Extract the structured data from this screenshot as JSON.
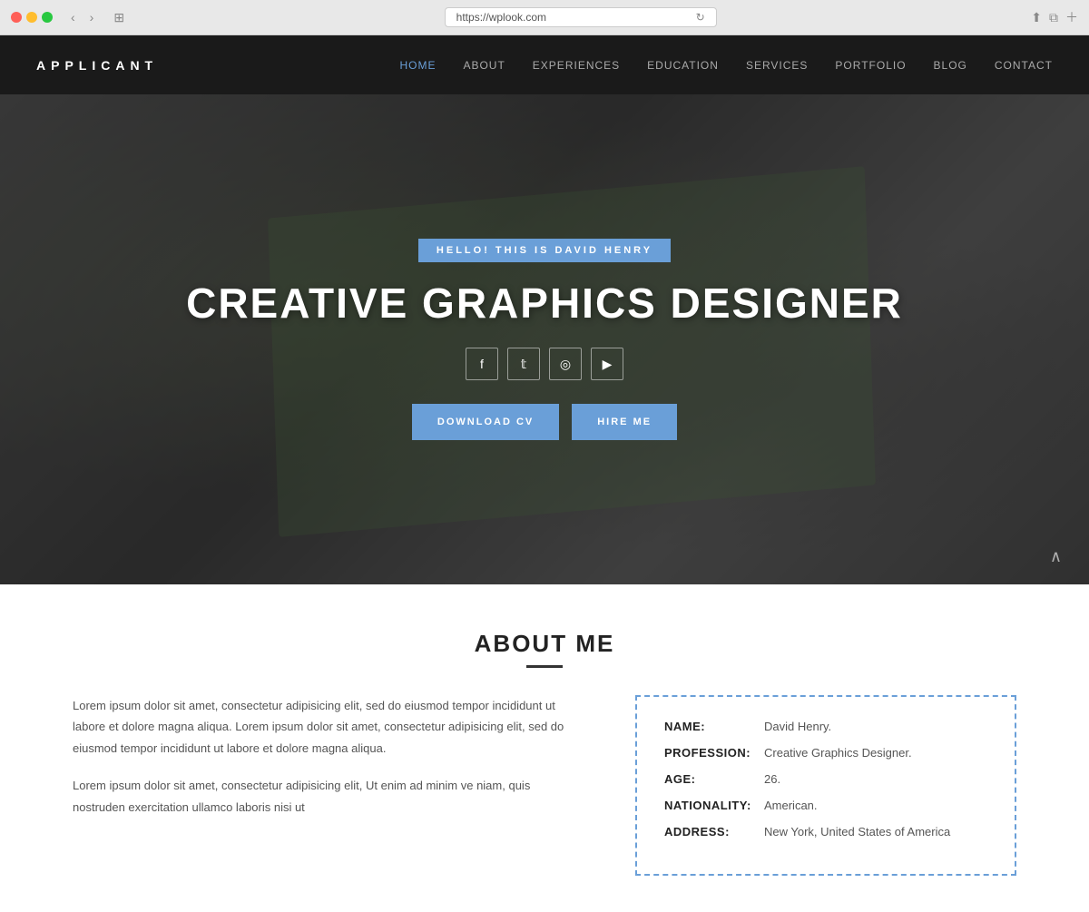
{
  "browser": {
    "url": "https://wplook.com",
    "refresh_icon": "↻"
  },
  "header": {
    "logo": "APPLICANT",
    "nav": [
      {
        "label": "HOME",
        "active": true
      },
      {
        "label": "ABOUT",
        "active": false
      },
      {
        "label": "EXPERIENCES",
        "active": false
      },
      {
        "label": "EDUCATION",
        "active": false
      },
      {
        "label": "SERVICES",
        "active": false
      },
      {
        "label": "PORTFOLIO",
        "active": false
      },
      {
        "label": "BLOG",
        "active": false
      },
      {
        "label": "CONTACT",
        "active": false
      }
    ]
  },
  "hero": {
    "badge": "HELLO! THIS IS DAVID HENRY",
    "title": "CREATIVE GRAPHICS DESIGNER",
    "social_icons": [
      "f",
      "t",
      "◎",
      "▶"
    ],
    "download_cv_label": "DOWNLOAD CV",
    "hire_me_label": "HIRE ME"
  },
  "about": {
    "section_title": "ABOUT ME",
    "paragraph1": "Lorem ipsum dolor sit amet, consectetur adipisicing elit, sed do eiusmod tempor incididunt ut labore et dolore magna aliqua. Lorem ipsum dolor sit amet, consectetur adipisicing elit, sed do eiusmod tempor incididunt ut labore et dolore magna aliqua.",
    "paragraph2": "Lorem ipsum dolor sit amet, consectetur adipisicing elit, Ut enim ad minim ve niam, quis nostruden exercitation ullamco laboris nisi ut",
    "info": {
      "name_label": "NAME:",
      "name_value": "David Henry.",
      "profession_label": "PROFESSION:",
      "profession_value": "Creative Graphics Designer.",
      "age_label": "AGE:",
      "age_value": "26.",
      "nationality_label": "NATIONALITY:",
      "nationality_value": "American.",
      "address_label": "ADDRESS:",
      "address_value": "New York, United States of America"
    }
  }
}
